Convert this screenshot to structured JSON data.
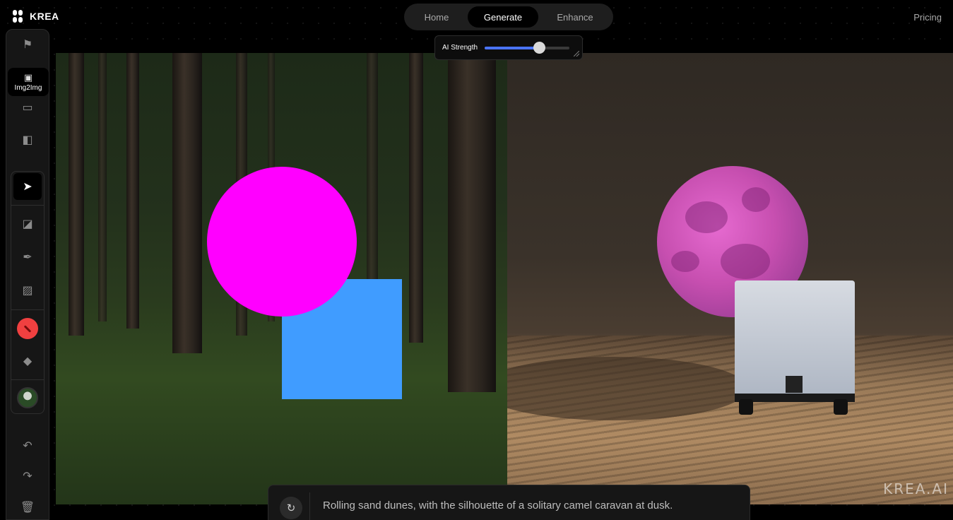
{
  "brand": {
    "name": "KREA"
  },
  "nav": {
    "tabs": [
      {
        "label": "Home"
      },
      {
        "label": "Generate"
      },
      {
        "label": "Enhance"
      }
    ],
    "active": "Generate"
  },
  "header": {
    "pricing_label": "Pricing"
  },
  "ai_strength": {
    "label": "AI Strength",
    "value_fraction": 0.64,
    "accent": "#4a74ff"
  },
  "toolbar": {
    "mode_label": "Img2Img",
    "icons": {
      "top": "flag-icon",
      "mode": "image-icon",
      "monitor": "monitor-icon",
      "video": "video-icon",
      "select": "cursor-icon",
      "shapes": "shapes-icon",
      "brush": "feather-icon",
      "image_add": "image-add-icon",
      "color": "color-picker-icon",
      "eraser": "eraser-icon",
      "background": "background-image-icon",
      "undo": "undo-icon",
      "redo": "redo-icon",
      "delete": "trash-icon"
    },
    "active_color": "#f04040"
  },
  "canvas": {
    "circle_color": "#ff00ff",
    "square_color": "#409cff"
  },
  "output": {
    "watermark": "KREA.AI"
  },
  "prompt": {
    "text": "Rolling sand dunes, with the silhouette of a solitary camel caravan at dusk."
  }
}
